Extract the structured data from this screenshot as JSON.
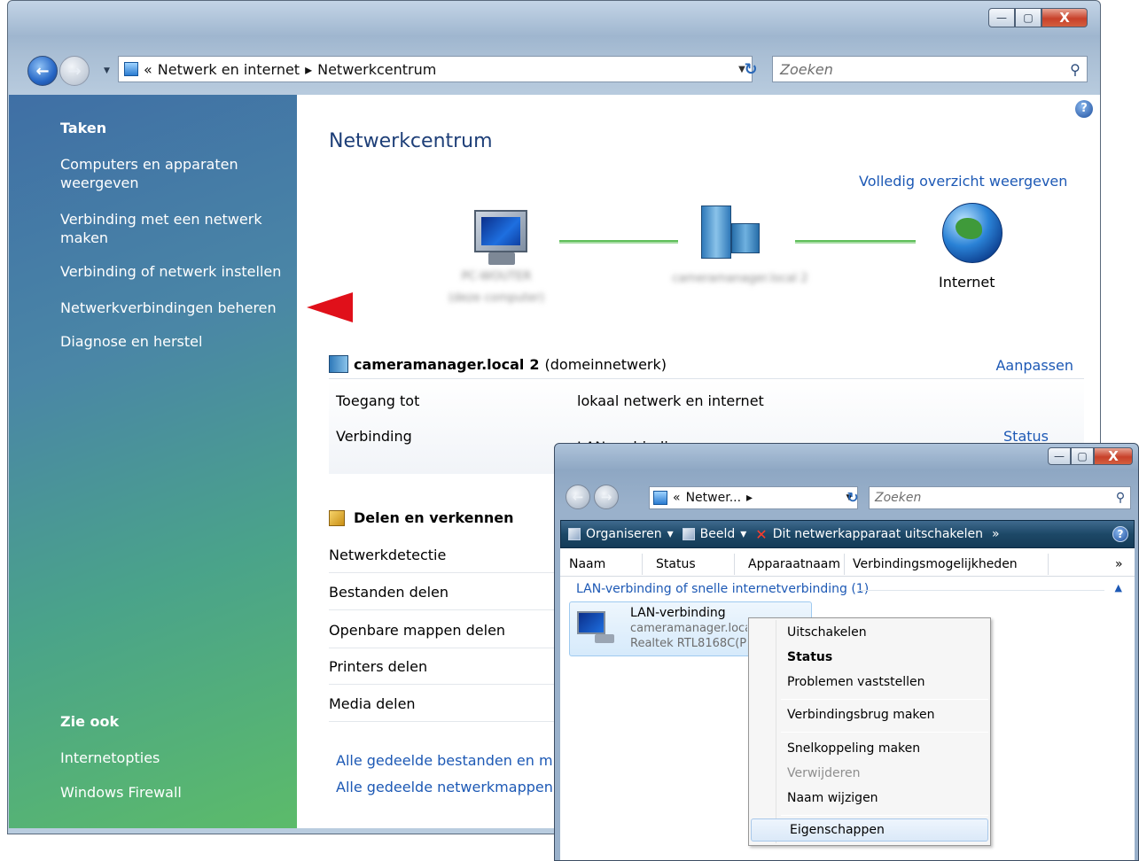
{
  "main_window": {
    "caption_buttons": {
      "minimize": "—",
      "maximize": "▢",
      "close": "X"
    },
    "address": {
      "prefix": "«",
      "crumb1": "Netwerk en internet",
      "sep": "▸",
      "crumb2": "Netwerkcentrum"
    },
    "search_placeholder": "Zoeken",
    "sidebar": {
      "tasks_header": "Taken",
      "tasks": [
        "Computers en apparaten weergeven",
        "Verbinding met een netwerk maken",
        "Verbinding of netwerk instellen",
        "Netwerkverbindingen beheren",
        "Diagnose en herstel"
      ],
      "see_also_header": "Zie ook",
      "see_also": [
        "Internetopties",
        "Windows Firewall"
      ]
    },
    "content": {
      "title": "Netwerkcentrum",
      "full_overview_link": "Volledig overzicht weergeven",
      "map": {
        "pc_label_line1": "PC-WOUTER",
        "pc_label_line2": "(deze computer)",
        "network_label": "cameramanager.local 2",
        "internet_label": "Internet"
      },
      "network": {
        "name": "cameramanager.local",
        "number": "2",
        "type": "(domeinnetwerk)",
        "customize_link": "Aanpassen",
        "access_label": "Toegang tot",
        "access_value": "lokaal netwerk en internet",
        "connection_label": "Verbinding",
        "connection_value": "LAN-verbinding",
        "status_link": "Status"
      },
      "sharing": {
        "header": "Delen en verkennen",
        "rows": [
          "Netwerkdetectie",
          "Bestanden delen",
          "Openbare mappen delen",
          "Printers delen",
          "Media delen"
        ]
      },
      "bottom_links": [
        "Alle gedeelde bestanden en m",
        "Alle gedeelde netwerkmappen"
      ]
    }
  },
  "connections_window": {
    "address": {
      "prefix": "«",
      "crumb": "Netwer...",
      "sep": "▸"
    },
    "search_placeholder": "Zoeken",
    "toolbar": {
      "organize": "Organiseren",
      "view": "Beeld",
      "disable_device": "Dit netwerkapparaat uitschakelen",
      "more": "»"
    },
    "columns": [
      "Naam",
      "Status",
      "Apparaatnaam",
      "Verbindingsmogelijkheden",
      "»"
    ],
    "group_header": "LAN-verbinding of snelle internetverbinding (1)",
    "item": {
      "name": "LAN-verbinding",
      "network": "cameramanager.local",
      "adapter": "Realtek RTL8168C(P)"
    }
  },
  "context_menu": {
    "items": [
      {
        "label": "Uitschakelen"
      },
      {
        "label": "Status"
      },
      {
        "label": "Problemen vaststellen"
      },
      {
        "label": "Verbindingsbrug maken"
      },
      {
        "label": "Snelkoppeling maken"
      },
      {
        "label": "Verwijderen"
      },
      {
        "label": "Naam wijzigen"
      },
      {
        "label": "Eigenschappen"
      }
    ]
  },
  "colors": {
    "link": "#1d59b5",
    "sidebar_top": "#3f6fa5",
    "sidebar_bottom": "#5cbb6a",
    "arrow": "#e0101a"
  }
}
